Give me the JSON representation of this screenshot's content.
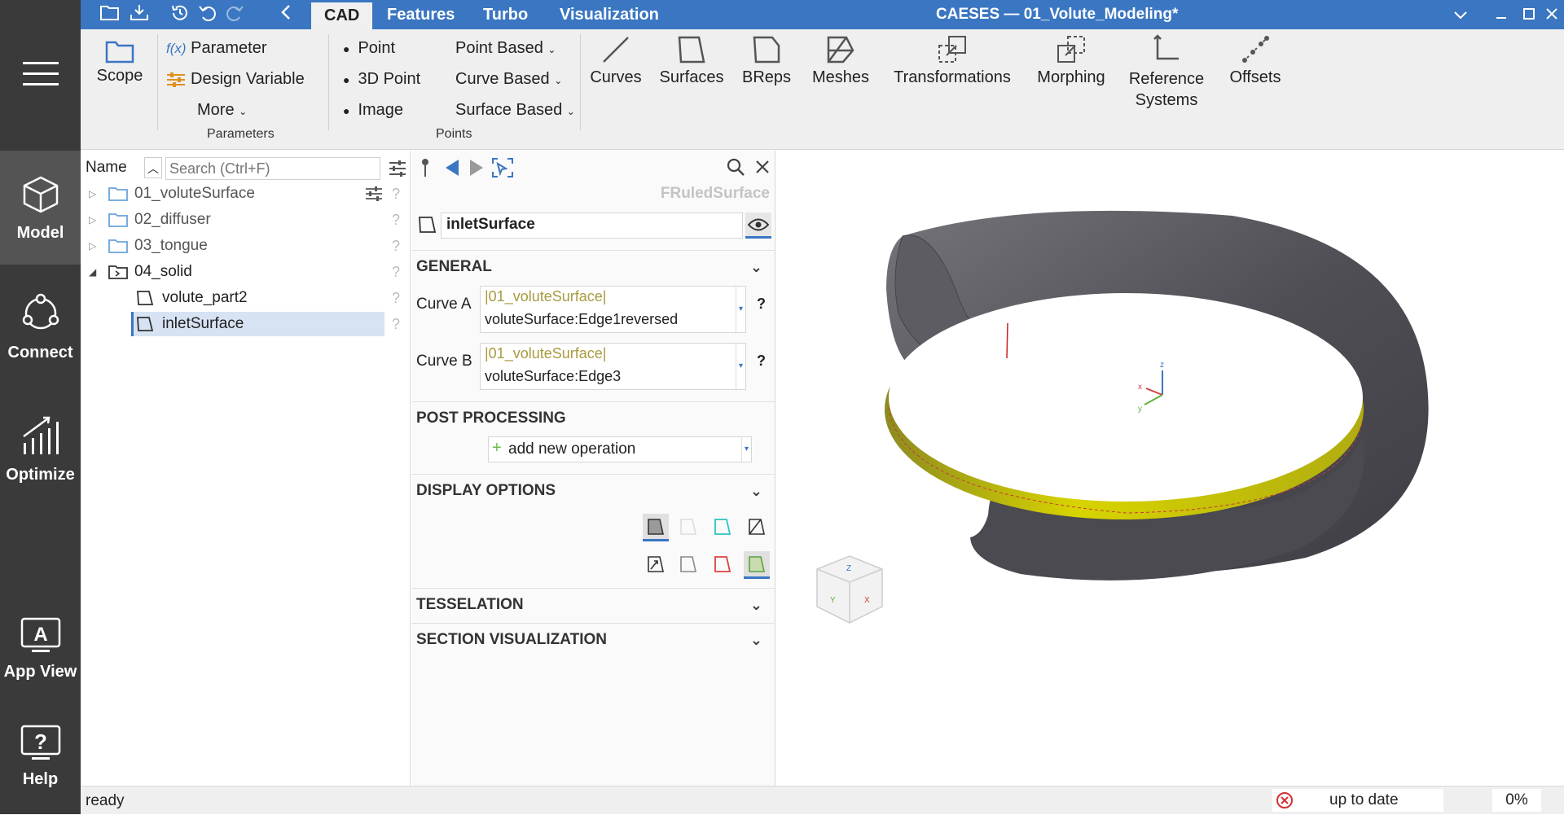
{
  "rail": {
    "model": "Model",
    "connect": "Connect",
    "optimize": "Optimize",
    "app_view": "App View",
    "help": "Help"
  },
  "topbar": {
    "tabs": [
      "CAD",
      "Features",
      "Turbo",
      "Visualization"
    ],
    "title": "CAESES — 01_Volute_Modeling*"
  },
  "ribbon": {
    "scope": "Scope",
    "parameter": "Parameter",
    "design_variable": "Design Variable",
    "more": "More",
    "parameters_group": "Parameters",
    "point": "Point",
    "point_3d": "3D Point",
    "image": "Image",
    "point_based": "Point Based",
    "curve_based": "Curve Based",
    "surface_based": "Surface Based",
    "points_group": "Points",
    "curves": "Curves",
    "surfaces": "Surfaces",
    "breps": "BReps",
    "meshes": "Meshes",
    "transformations": "Transformations",
    "morphing": "Morphing",
    "reference_systems_1": "Reference",
    "reference_systems_2": "Systems",
    "offsets": "Offsets",
    "fx": "f(x)"
  },
  "tree": {
    "header": "Name",
    "search_placeholder": "Search (Ctrl+F)",
    "items": [
      {
        "label": "01_voluteSurface"
      },
      {
        "label": "02_diffuser"
      },
      {
        "label": "03_tongue"
      },
      {
        "label": "04_solid"
      },
      {
        "label": "volute_part2"
      },
      {
        "label": "inletSurface"
      }
    ]
  },
  "props": {
    "type": "FRuledSurface",
    "name_value": "inletSurface",
    "general": "GENERAL",
    "curve_a_label": "Curve A",
    "curve_a_scope": "|01_voluteSurface|",
    "curve_a_value": "voluteSurface:Edge1reversed",
    "curve_b_label": "Curve B",
    "curve_b_scope": "|01_voluteSurface|",
    "curve_b_value": "voluteSurface:Edge3",
    "post_processing": "POST PROCESSING",
    "add_operation": "add new operation",
    "display_options": "DISPLAY OPTIONS",
    "tesselation": "TESSELATION",
    "section_visualization": "SECTION VISUALIZATION",
    "help_mark": "?"
  },
  "status": {
    "text": "ready",
    "state": "up to date",
    "progress": "0%"
  },
  "colors": {
    "topbar": "#3a76c2",
    "rail": "#3a3a3a",
    "accent_yellow": "#d8d400",
    "volute_gray": "#5a5a5e"
  }
}
